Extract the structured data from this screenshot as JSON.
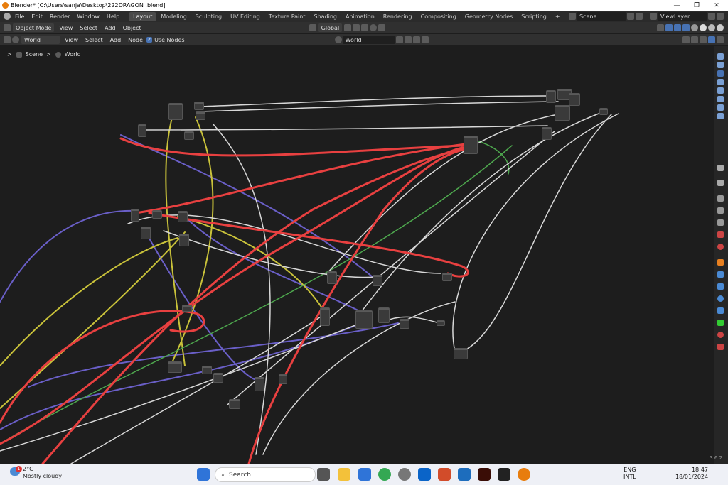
{
  "window": {
    "title": "Blender* [C:\\Users\\sanja\\Desktop\\222DRAGON .blend]",
    "controls": [
      "—",
      "❐",
      "✕"
    ]
  },
  "menubar": {
    "menus": [
      "File",
      "Edit",
      "Render",
      "Window",
      "Help"
    ],
    "workspaces": [
      "Layout",
      "Modeling",
      "Sculpting",
      "UV Editing",
      "Texture Paint",
      "Shading",
      "Animation",
      "Rendering",
      "Compositing",
      "Geometry Nodes",
      "Scripting"
    ],
    "active_workspace": "Layout",
    "add_workspace": "+",
    "scene": "Scene",
    "view_layer": "ViewLayer"
  },
  "header1": {
    "mode": "Object Mode",
    "menus": [
      "View",
      "Select",
      "Add",
      "Object"
    ],
    "orientation": "Global"
  },
  "header2": {
    "shader_type": "World",
    "menus": [
      "View",
      "Select",
      "Add",
      "Node"
    ],
    "use_nodes_label": "Use Nodes",
    "world_name": "World"
  },
  "breadcrumb": {
    "scene": "Scene",
    "world": "World",
    "separator": ">"
  },
  "status": {
    "version": "3.6.2"
  },
  "taskbar": {
    "weather_temp": "2°C",
    "weather_desc": "Mostly cloudy",
    "weather_badge": "1",
    "search_placeholder": "Search",
    "lang_line1": "ENG",
    "lang_line2": "INTL",
    "time": "18:47",
    "date": "18/01/2024"
  },
  "colors": {
    "accent": "#4772b3",
    "wire_red": "#e84040",
    "wire_white": "#d8d8d8",
    "wire_yellow": "#c9c23a",
    "wire_purple": "#6a5fc8",
    "wire_green": "#4ea84e"
  }
}
